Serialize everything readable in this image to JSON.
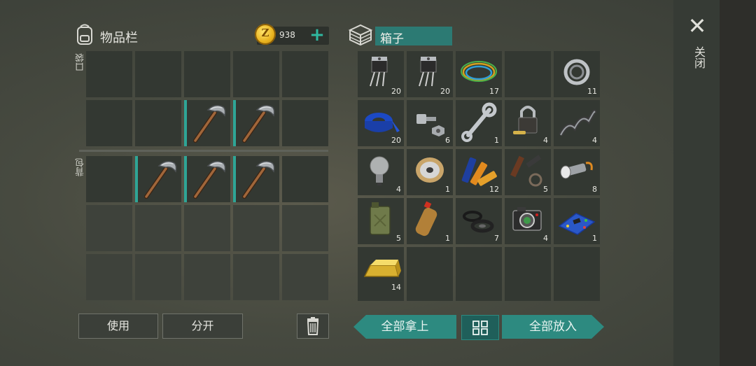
{
  "inventory": {
    "title": "物品栏",
    "coins": "938",
    "coin_symbol": "Z",
    "pocket_label": "口袋",
    "backpack_label": "背包",
    "use_label": "使用",
    "split_label": "分开"
  },
  "box": {
    "title": "箱子",
    "take_all_label": "全部拿上",
    "put_all_label": "全部放入",
    "items": [
      {
        "name": "transistor",
        "count": "20"
      },
      {
        "name": "transistor",
        "count": "20"
      },
      {
        "name": "wires",
        "count": "17"
      },
      {
        "name": "",
        "count": ""
      },
      {
        "name": "bearing",
        "count": "11"
      },
      {
        "name": "tape",
        "count": "20"
      },
      {
        "name": "bolt-nut",
        "count": "6"
      },
      {
        "name": "wrench",
        "count": "1"
      },
      {
        "name": "padlock",
        "count": "4"
      },
      {
        "name": "spring",
        "count": "4"
      },
      {
        "name": "light-bulb",
        "count": "4"
      },
      {
        "name": "wire-spool",
        "count": "1"
      },
      {
        "name": "batteries",
        "count": "12"
      },
      {
        "name": "gun-parts",
        "count": "5"
      },
      {
        "name": "flashlight",
        "count": "8"
      },
      {
        "name": "jerrycan",
        "count": "5"
      },
      {
        "name": "plastic-bottle",
        "count": "1"
      },
      {
        "name": "rubber-rings",
        "count": "7"
      },
      {
        "name": "camera",
        "count": "4"
      },
      {
        "name": "circuit-board",
        "count": "1"
      },
      {
        "name": "gold-bar",
        "count": "14"
      }
    ]
  },
  "close_label": "关闭",
  "colors": {
    "accent": "#2d8a80",
    "selected": "#2fa596",
    "coin": "#e8b21e"
  }
}
